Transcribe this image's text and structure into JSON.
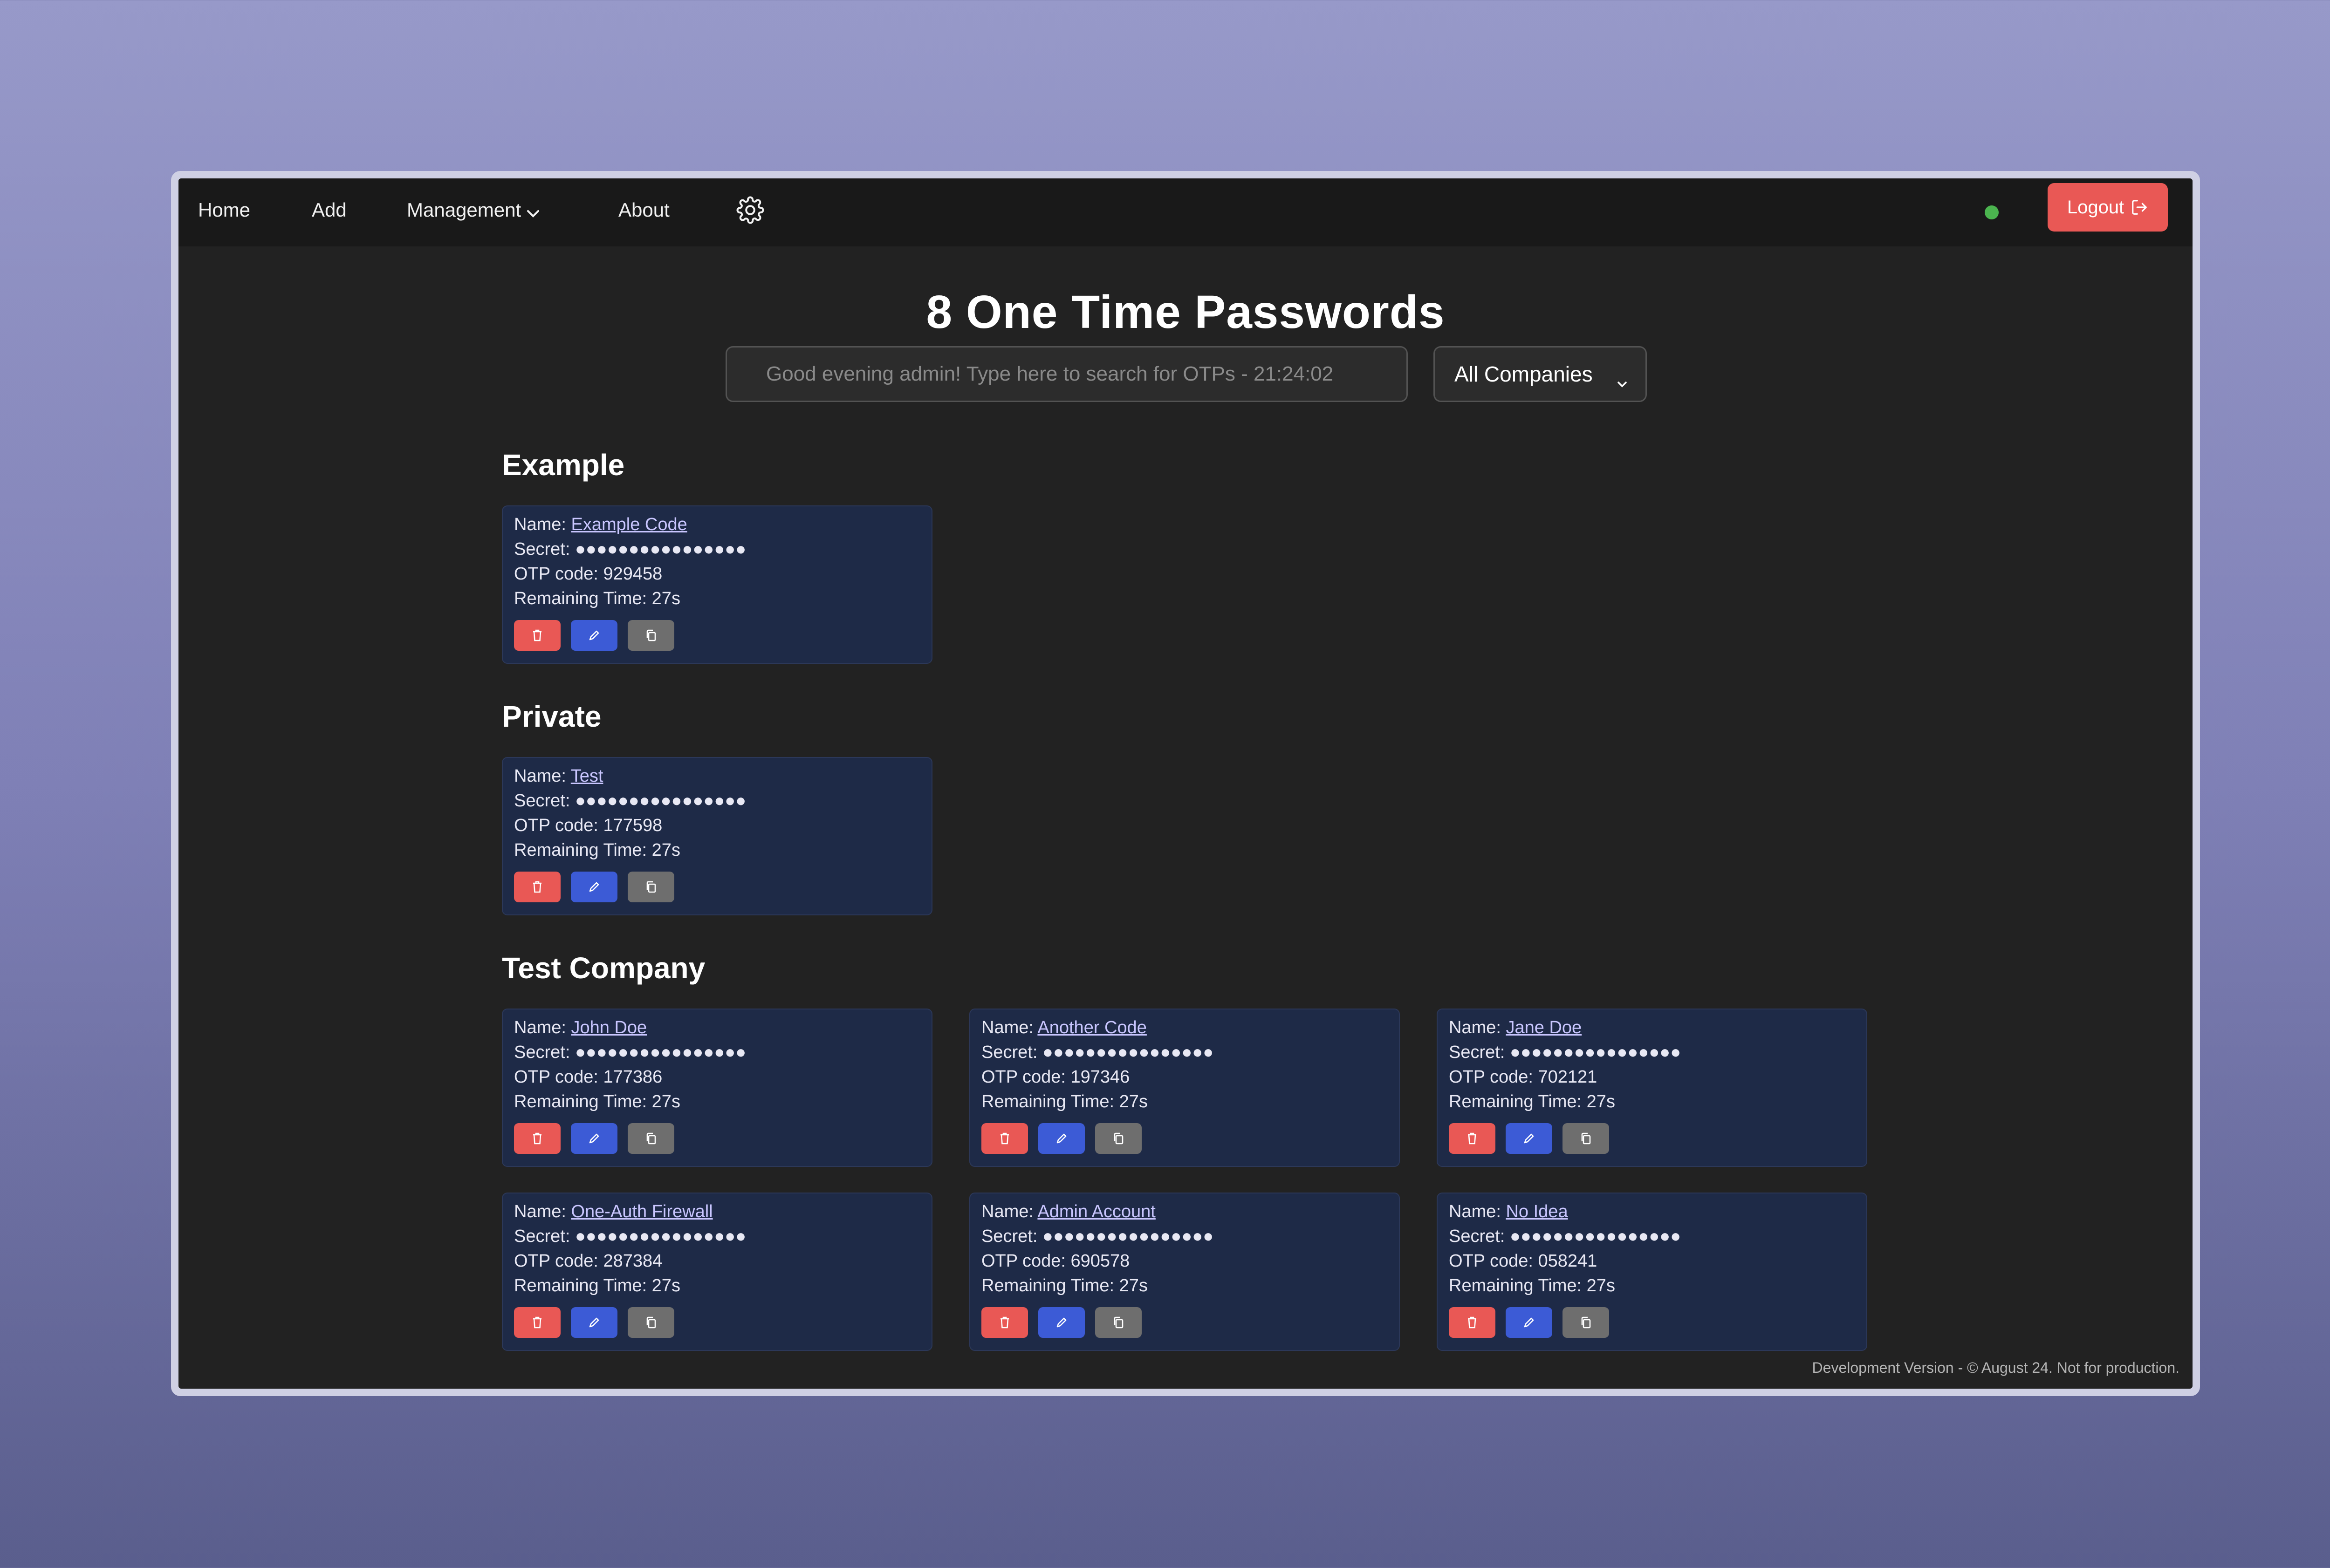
{
  "nav": {
    "home": "Home",
    "add": "Add",
    "management": "Management",
    "about": "About",
    "logout": "Logout"
  },
  "colors": {
    "status_online": "#4bb44f",
    "delete": "#e95855",
    "edit": "#3c5bd6",
    "copy": "#6e6e6e",
    "card_bg": "#1e2a47"
  },
  "header": {
    "title": "8 One Time Passwords",
    "search_placeholder": "Good evening admin! Type here to search for OTPs - 21:24:02",
    "company_filter": "All Companies"
  },
  "labels": {
    "name": "Name: ",
    "secret": "Secret: ",
    "otp": "OTP code: ",
    "remaining": "Remaining Time: "
  },
  "sections": [
    {
      "title": "Example",
      "cards": [
        {
          "name": "Example Code",
          "secret": "●●●●●●●●●●●●●●●●",
          "otp": "929458",
          "remaining": "27s"
        }
      ]
    },
    {
      "title": "Private",
      "cards": [
        {
          "name": "Test",
          "secret": "●●●●●●●●●●●●●●●●",
          "otp": "177598",
          "remaining": "27s"
        }
      ]
    },
    {
      "title": "Test Company",
      "cards": [
        {
          "name": "John Doe",
          "secret": "●●●●●●●●●●●●●●●●",
          "otp": "177386",
          "remaining": "27s"
        },
        {
          "name": "Another Code",
          "secret": "●●●●●●●●●●●●●●●●",
          "otp": "197346",
          "remaining": "27s"
        },
        {
          "name": "Jane Doe",
          "secret": "●●●●●●●●●●●●●●●●",
          "otp": "702121",
          "remaining": "27s"
        },
        {
          "name": "One-Auth Firewall",
          "secret": "●●●●●●●●●●●●●●●●",
          "otp": "287384",
          "remaining": "27s"
        },
        {
          "name": "Admin Account",
          "secret": "●●●●●●●●●●●●●●●●",
          "otp": "690578",
          "remaining": "27s"
        },
        {
          "name": "No Idea",
          "secret": "●●●●●●●●●●●●●●●●",
          "otp": "058241",
          "remaining": "27s"
        }
      ]
    }
  ],
  "footer": "Development Version - © August 24. Not for production."
}
